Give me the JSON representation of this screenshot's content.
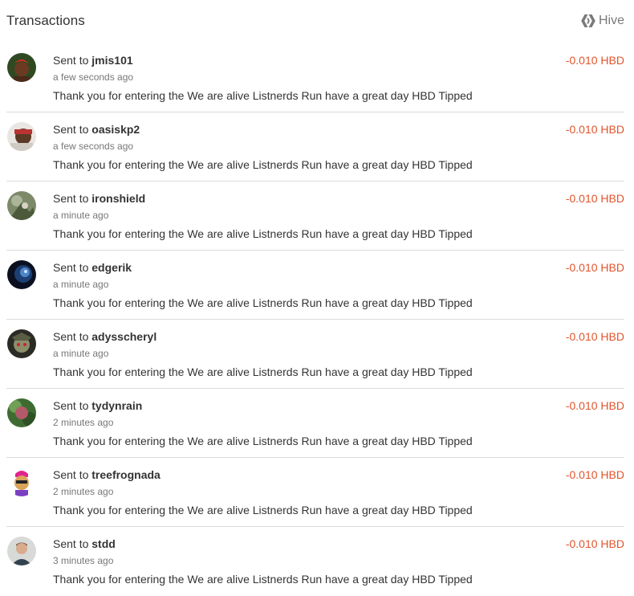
{
  "header": {
    "title": "Transactions",
    "brand": "Hive",
    "brand_icon": "hive-logo-icon"
  },
  "colors": {
    "amount": "#e1542c",
    "divider": "#dcdcdc",
    "muted": "#777777"
  },
  "transactions": [
    {
      "prefix": "Sent to",
      "user": "jmis101",
      "time": "a few seconds ago",
      "memo": "Thank you for entering the We are alive Listnerds Run have a great day HBD Tipped",
      "amount": "-0.010 HBD"
    },
    {
      "prefix": "Sent to",
      "user": "oasiskp2",
      "time": "a few seconds ago",
      "memo": "Thank you for entering the We are alive Listnerds Run have a great day HBD Tipped",
      "amount": "-0.010 HBD"
    },
    {
      "prefix": "Sent to",
      "user": "ironshield",
      "time": "a minute ago",
      "memo": "Thank you for entering the We are alive Listnerds Run have a great day HBD Tipped",
      "amount": "-0.010 HBD"
    },
    {
      "prefix": "Sent to",
      "user": "edgerik",
      "time": "a minute ago",
      "memo": "Thank you for entering the We are alive Listnerds Run have a great day HBD Tipped",
      "amount": "-0.010 HBD"
    },
    {
      "prefix": "Sent to",
      "user": "adysscheryl",
      "time": "a minute ago",
      "memo": "Thank you for entering the We are alive Listnerds Run have a great day HBD Tipped",
      "amount": "-0.010 HBD"
    },
    {
      "prefix": "Sent to",
      "user": "tydynrain",
      "time": "2 minutes ago",
      "memo": "Thank you for entering the We are alive Listnerds Run have a great day HBD Tipped",
      "amount": "-0.010 HBD"
    },
    {
      "prefix": "Sent to",
      "user": "treefrognada",
      "time": "2 minutes ago",
      "memo": "Thank you for entering the We are alive Listnerds Run have a great day HBD Tipped",
      "amount": "-0.010 HBD"
    },
    {
      "prefix": "Sent to",
      "user": "stdd",
      "time": "3 minutes ago",
      "memo": "Thank you for entering the We are alive Listnerds Run have a great day HBD Tipped",
      "amount": "-0.010 HBD"
    }
  ]
}
